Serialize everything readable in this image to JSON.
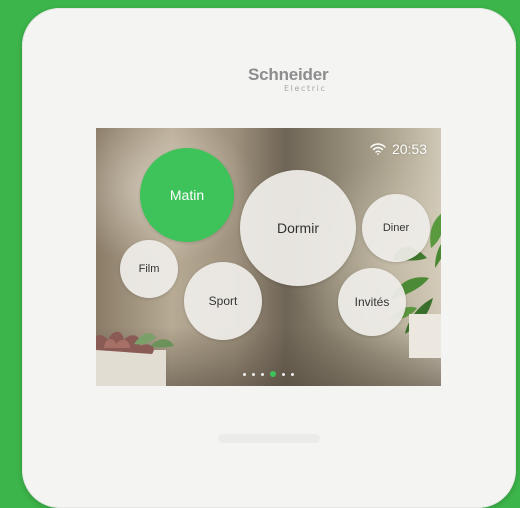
{
  "brand": {
    "name": "Schneider",
    "subtitle": "Electric"
  },
  "status": {
    "time": "20:53",
    "wifi_icon": "wifi-icon"
  },
  "scenes": {
    "matin": "Matin",
    "dormir": "Dormir",
    "diner": "Diner",
    "film": "Film",
    "sport": "Sport",
    "invites": "Invités"
  },
  "active_scene": "Matin",
  "pager": {
    "count": 6,
    "active_index": 3
  },
  "colors": {
    "background": "#3cb54a",
    "accent": "#3ec25a",
    "device": "#f4f4f3"
  }
}
